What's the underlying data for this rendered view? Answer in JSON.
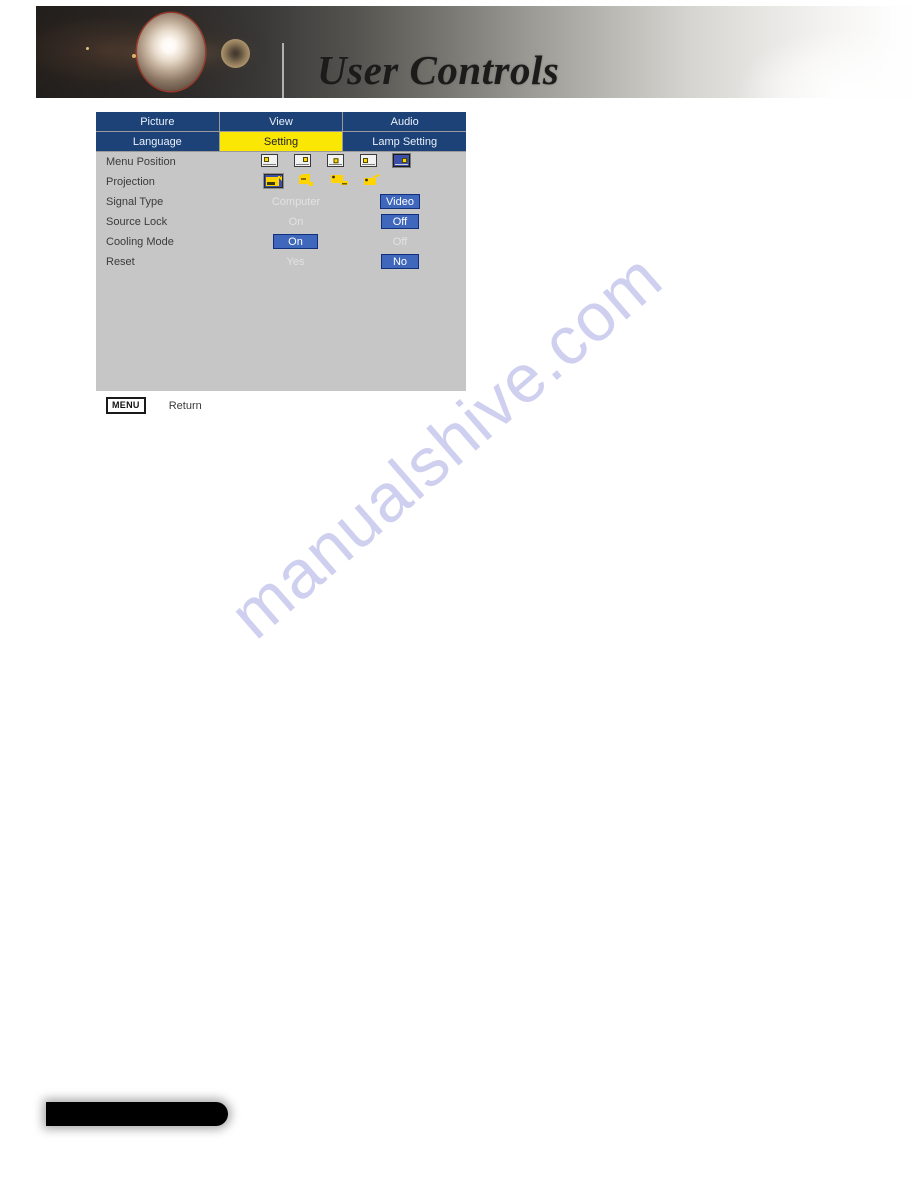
{
  "header": {
    "title": "User Controls",
    "icons": {
      "lens_flare": "lens-flare-icon",
      "lens_flare_secondary": "lens-flare-secondary-icon"
    }
  },
  "watermark": {
    "text": "manualshive.com"
  },
  "osd": {
    "tabs_row1": [
      {
        "label": "Picture",
        "active": false
      },
      {
        "label": "View",
        "active": false
      },
      {
        "label": "Audio",
        "active": false
      }
    ],
    "tabs_row2": [
      {
        "label": "Language",
        "active": false
      },
      {
        "label": "Setting",
        "active": true
      },
      {
        "label": "Lamp Setting",
        "active": false
      }
    ],
    "rows": [
      {
        "label": "Menu Position",
        "type": "icons"
      },
      {
        "label": "Projection",
        "type": "icons"
      },
      {
        "label": "Signal Type",
        "type": "choice",
        "left": "Computer",
        "right": "Video",
        "selected": "right"
      },
      {
        "label": "Source Lock",
        "type": "choice",
        "left": "On",
        "right": "Off",
        "selected": "right"
      },
      {
        "label": "Cooling Mode",
        "type": "choice",
        "left": "On",
        "right": "Off",
        "selected": "left"
      },
      {
        "label": "Reset",
        "type": "choice",
        "left": "Yes",
        "right": "No",
        "selected": "right"
      }
    ],
    "menu_position_icons": [
      {
        "name": "menu-position-top-left-icon",
        "position": "top-left",
        "selected": false
      },
      {
        "name": "menu-position-top-right-icon",
        "position": "top-right",
        "selected": false
      },
      {
        "name": "menu-position-center-icon",
        "position": "center",
        "selected": false
      },
      {
        "name": "menu-position-bottom-left-icon",
        "position": "bottom-left",
        "selected": false
      },
      {
        "name": "menu-position-bottom-right-icon",
        "position": "bottom-right",
        "selected": true
      }
    ],
    "projection_icons": [
      {
        "name": "projection-front-desktop-icon",
        "selected": true
      },
      {
        "name": "projection-rear-desktop-icon",
        "selected": false
      },
      {
        "name": "projection-front-ceiling-icon",
        "selected": false
      },
      {
        "name": "projection-rear-ceiling-icon",
        "selected": false
      }
    ],
    "footer": {
      "key_label": "MENU",
      "action_label": "Return"
    }
  },
  "colors": {
    "tab_blue": "#1c4277",
    "tab_active_yellow": "#fbe704",
    "panel_gray": "#c6c6c6",
    "pill_blue": "#3f68bc",
    "pill_border": "#11307c",
    "icon_yellow": "#ffd400",
    "label_gray": "#3b3b3b",
    "washed_text": "#e2e2e2",
    "watermark_lilac": "#cfd0ef"
  }
}
